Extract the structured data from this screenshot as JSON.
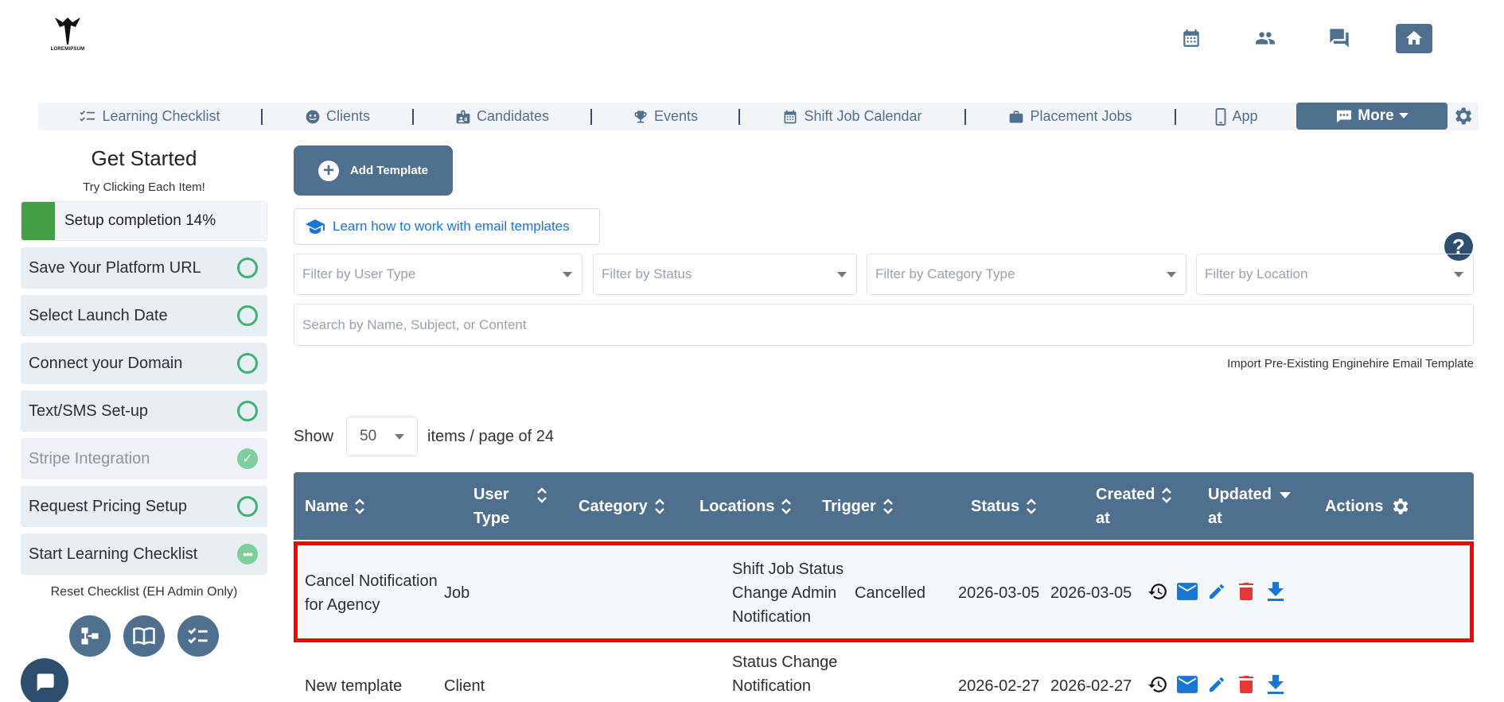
{
  "brand": {
    "logo_text": "LOREMIPSUM"
  },
  "top_icons": [
    "calendar-icon",
    "people-icon",
    "chat-icon",
    "home-icon"
  ],
  "nav": {
    "items": [
      {
        "label": "Learning Checklist",
        "icon": "checklist-icon"
      },
      {
        "label": "Clients",
        "icon": "face-icon"
      },
      {
        "label": "Candidates",
        "icon": "id-badge-icon"
      },
      {
        "label": "Events",
        "icon": "trophy-icon"
      },
      {
        "label": "Shift Job Calendar",
        "icon": "calendar-icon"
      },
      {
        "label": "Placement Jobs",
        "icon": "briefcase-icon"
      },
      {
        "label": "App",
        "icon": "phone-icon"
      }
    ],
    "more_label": "More"
  },
  "sidebar": {
    "title": "Get Started",
    "subtitle": "Try Clicking Each Item!",
    "progress_label": "Setup completion 14%",
    "progress_percent": 14,
    "items": [
      {
        "label": "Save Your Platform URL",
        "state": "pending"
      },
      {
        "label": "Select Launch Date",
        "state": "pending"
      },
      {
        "label": "Connect your Domain",
        "state": "pending"
      },
      {
        "label": "Text/SMS Set-up",
        "state": "pending"
      },
      {
        "label": "Stripe Integration",
        "state": "done"
      },
      {
        "label": "Request Pricing Setup",
        "state": "pending"
      },
      {
        "label": "Start Learning Checklist",
        "state": "in-progress"
      }
    ],
    "reset_label": "Reset Checklist (EH Admin Only)"
  },
  "toolbar": {
    "add_label": "Add Template",
    "learn_label": "Learn how to work with email templates",
    "help_label": "?"
  },
  "filters": {
    "user_type": "Filter by User Type",
    "status": "Filter by Status",
    "category": "Filter by Category Type",
    "location": "Filter by Location",
    "search_placeholder": "Search by Name, Subject, or Content",
    "import_label": "Import Pre-Existing Enginehire Email Template"
  },
  "pagination": {
    "show": "Show",
    "per_page": "50",
    "suffix": "items / page of 24"
  },
  "table": {
    "headers": {
      "name": "Name",
      "user_type_1": "User",
      "user_type_2": "Type",
      "category": "Category",
      "locations": "Locations",
      "trigger": "Trigger",
      "status": "Status",
      "created_1": "Created",
      "created_2": "at",
      "updated_1": "Updated",
      "updated_2": "at",
      "actions": "Actions"
    },
    "rows": [
      {
        "name_1": "Cancel Notification",
        "name_2": "for Agency",
        "user_type": "Job",
        "trigger_1": "Shift Job Status",
        "trigger_2": "Change Admin",
        "trigger_3": "Notification",
        "status": "Cancelled",
        "created": "2026-03-05",
        "updated": "2026-03-05"
      },
      {
        "name_1": "New template",
        "user_type": "Client",
        "trigger_1": "Status Change",
        "trigger_2": "Notification",
        "status": "",
        "created": "2026-02-27",
        "updated": "2026-02-27"
      }
    ]
  },
  "colors": {
    "primary": "#4f6f8f",
    "link": "#1976d2",
    "success": "#3cb371",
    "danger": "#e53935",
    "highlight": "#ff0000"
  }
}
